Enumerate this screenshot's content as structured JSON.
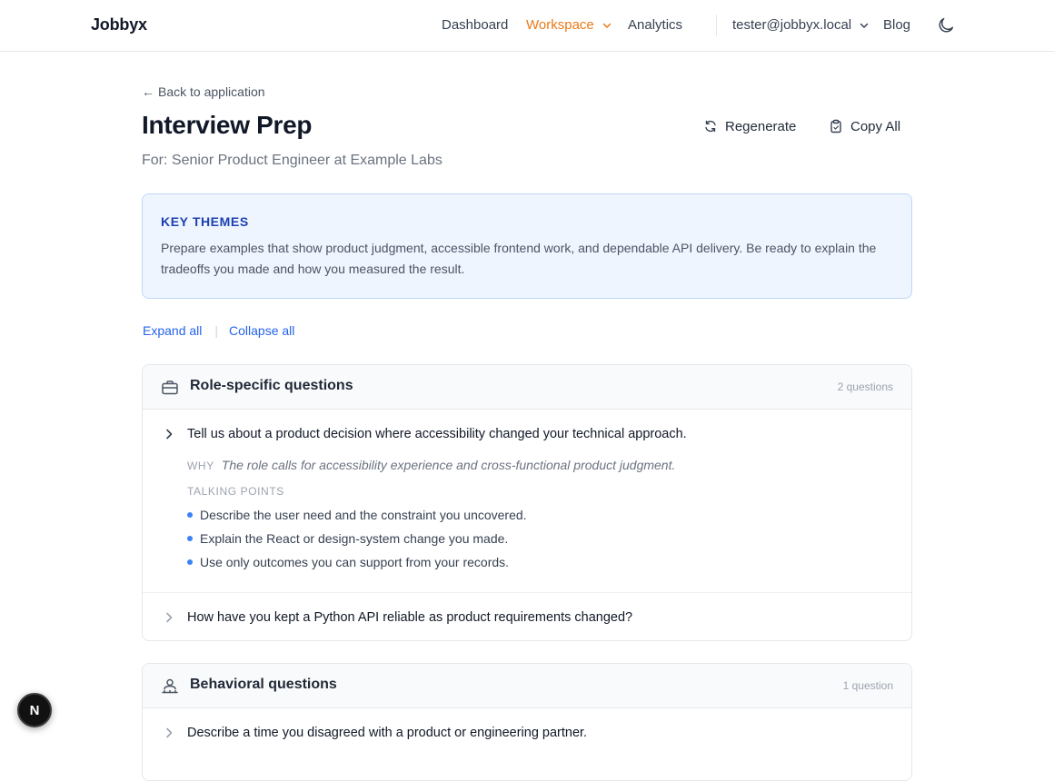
{
  "nav": {
    "brand": "Jobbyx",
    "links": [
      {
        "label": "Dashboard"
      },
      {
        "label": "Workspace"
      },
      {
        "label": "Analytics"
      }
    ],
    "user_email": "tester@jobbyx.local",
    "blog": "Blog",
    "theme_icon": "moon-icon",
    "active_color": "#ea7a17"
  },
  "header": {
    "back_label": "Back to application",
    "title": "Interview Prep",
    "subtitle": "For: Senior Product Engineer at Example Labs",
    "regenerate_label": "Regenerate",
    "copy_all_label": "Copy All"
  },
  "themes": {
    "title": "KEY THEMES",
    "body": "Prepare examples that show product judgment, accessible frontend work, and dependable API delivery. Be ready to explain the tradeoffs you made and how you measured the result."
  },
  "toggles": {
    "expand": "Expand all",
    "separator": "|",
    "collapse": "Collapse all"
  },
  "sections": [
    {
      "title": "Role-specific questions",
      "count": "2 questions",
      "icon": "briefcase-icon",
      "questions": [
        {
          "text": "Tell us about a product decision where accessibility changed your technical approach.",
          "expanded": true,
          "why_label": "WHY",
          "why": "The role calls for accessibility experience and cross-functional product judgment.",
          "talking_points_label": "TALKING POINTS",
          "talking_points": [
            "Describe the user need and the constraint you uncovered.",
            "Explain the React or design-system change you made.",
            "Use only outcomes you can support from your records."
          ]
        },
        {
          "text": "How have you kept a Python API reliable as product requirements changed?",
          "expanded": false
        }
      ]
    },
    {
      "title": "Behavioral questions",
      "count": "1 question",
      "icon": "people-icon",
      "questions": [
        {
          "text": "Describe a time you disagreed with a product or engineering partner.",
          "expanded": false
        }
      ]
    }
  ],
  "float_badge": "N"
}
